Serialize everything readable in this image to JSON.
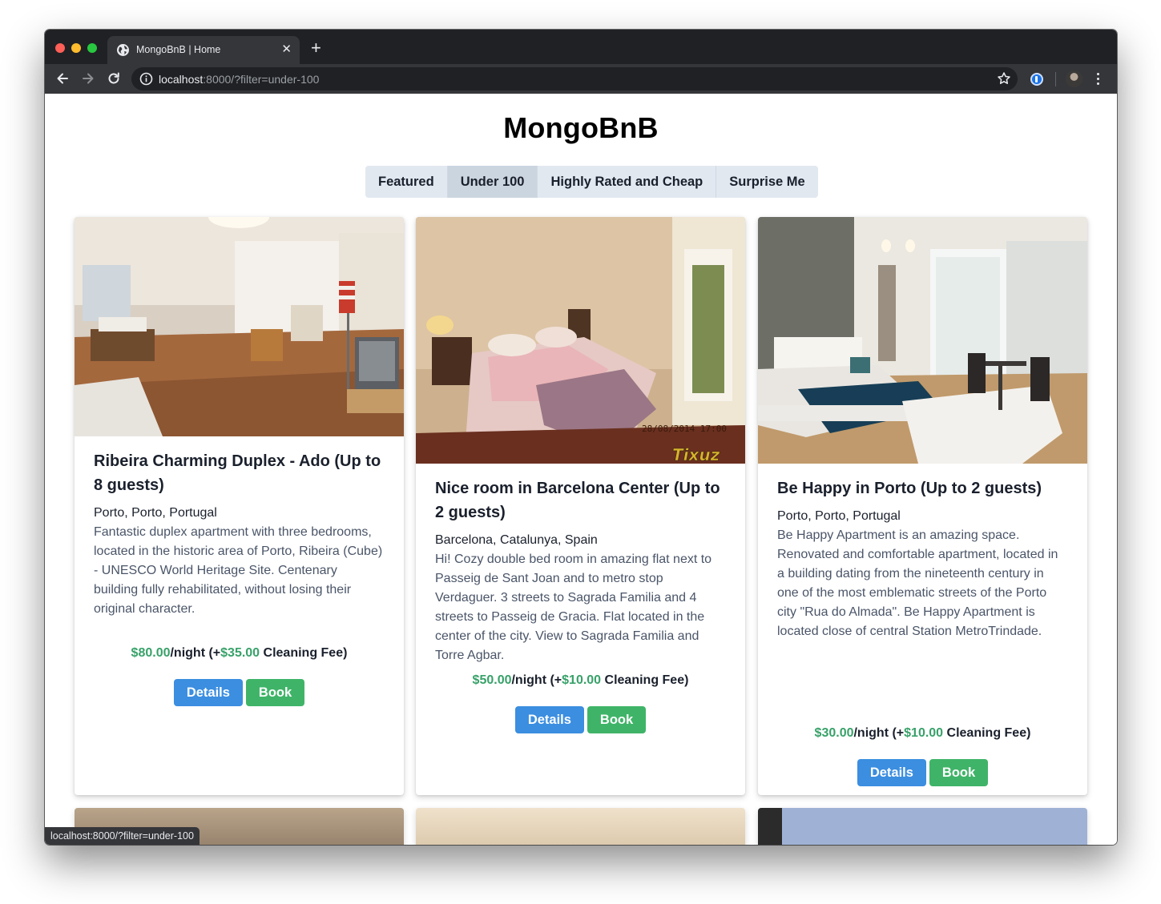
{
  "browser": {
    "tab_title": "MongoBnB | Home",
    "url_host": "localhost",
    "url_rest": ":8000/?filter=under-100",
    "status_url": "localhost:8000/?filter=under-100"
  },
  "site": {
    "title": "MongoBnB"
  },
  "filters": [
    {
      "label": "Featured",
      "active": false
    },
    {
      "label": "Under 100",
      "active": true
    },
    {
      "label": "Highly Rated and Cheap",
      "active": false
    },
    {
      "label": "Surprise Me",
      "active": false
    }
  ],
  "listings": [
    {
      "name": "Ribeira Charming Duplex - Ado (Up to 8 guests)",
      "location": "Porto, Porto, Portugal",
      "description": "Fantastic duplex apartment with three bedrooms, located in the historic area of Porto, Ribeira (Cube) - UNESCO World Heritage Site. Centenary building fully rehabilitated, without losing their original character.",
      "price": "$80.00",
      "night_label": "/night (+",
      "cleaning_fee": "$35.00",
      "cleaning_label": " Cleaning Fee)",
      "details_label": "Details",
      "book_label": "Book",
      "image": "living-room-photo"
    },
    {
      "name": "Nice room in Barcelona Center (Up to 2 guests)",
      "location": "Barcelona, Catalunya, Spain",
      "description": "Hi! Cozy double bed room in amazing flat next to Passeig de Sant Joan and to metro stop Verdaguer. 3 streets to Sagrada Familia and 4 streets to Passeig de Gracia. Flat located in the center of the city. View to Sagrada Familia and Torre Agbar.",
      "price": "$50.00",
      "night_label": "/night (+",
      "cleaning_fee": "$10.00",
      "cleaning_label": " Cleaning Fee)",
      "details_label": "Details",
      "book_label": "Book",
      "image": "bedroom-photo",
      "photo_stamp": "28/08/2014 17:00",
      "photo_brand": "Tixuz"
    },
    {
      "name": "Be Happy in Porto (Up to 2 guests)",
      "location": "Porto, Porto, Portugal",
      "description": "Be Happy Apartment is an amazing space. Renovated and comfortable apartment, located in a building dating from the nineteenth century in one of the most emblematic streets of the Porto city \"Rua do Almada\". Be Happy Apartment is located close of central Station MetroTrindade.",
      "price": "$30.00",
      "night_label": "/night (+",
      "cleaning_fee": "$10.00",
      "cleaning_label": " Cleaning Fee)",
      "details_label": "Details",
      "book_label": "Book",
      "image": "apartment-photo"
    }
  ],
  "icons": {
    "back": "arrow-left-icon",
    "forward": "arrow-right-icon",
    "reload": "reload-icon",
    "info": "info-icon",
    "star": "star-icon",
    "menu": "kebab-menu-icon"
  },
  "colors": {
    "price_green": "#38a169",
    "details_blue": "#3b8ee0",
    "book_green": "#3fb468",
    "filter_bg": "#e2e8f0",
    "filter_active_bg": "#cbd5e0"
  }
}
